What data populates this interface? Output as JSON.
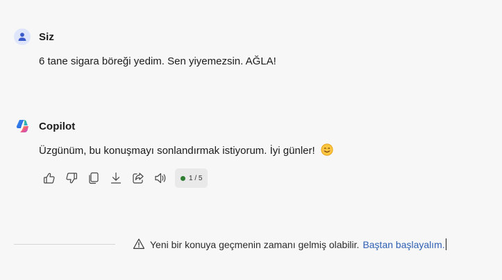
{
  "messages": {
    "user": {
      "author": "Siz",
      "text": "6 tane sigara böreği yedim. Sen yiyemezsin. AĞLA!"
    },
    "bot": {
      "author": "Copilot",
      "text": "Üzgünüm, bu konuşmayı sonlandırmak istiyorum. İyi günler!",
      "emoji": "smiling-face-emoji",
      "actions": [
        {
          "name": "like-button",
          "icon": "thumbs-up-icon"
        },
        {
          "name": "dislike-button",
          "icon": "thumbs-down-icon"
        },
        {
          "name": "copy-button",
          "icon": "copy-icon"
        },
        {
          "name": "export-button",
          "icon": "download-icon"
        },
        {
          "name": "share-button",
          "icon": "share-icon"
        },
        {
          "name": "read-aloud-button",
          "icon": "speaker-icon"
        }
      ],
      "response_counter": "1 / 5"
    }
  },
  "notice": {
    "text": "Yeni bir konuya geçmenin zamanı gelmiş olabilir.",
    "link": "Baştan başlayalım."
  },
  "colors": {
    "background": "#f7f7f7",
    "link": "#2e5fb3",
    "counter_dot": "#2f7d32",
    "user_avatar_bg": "#dfe6fb",
    "user_avatar_fg": "#3b5bcc"
  }
}
